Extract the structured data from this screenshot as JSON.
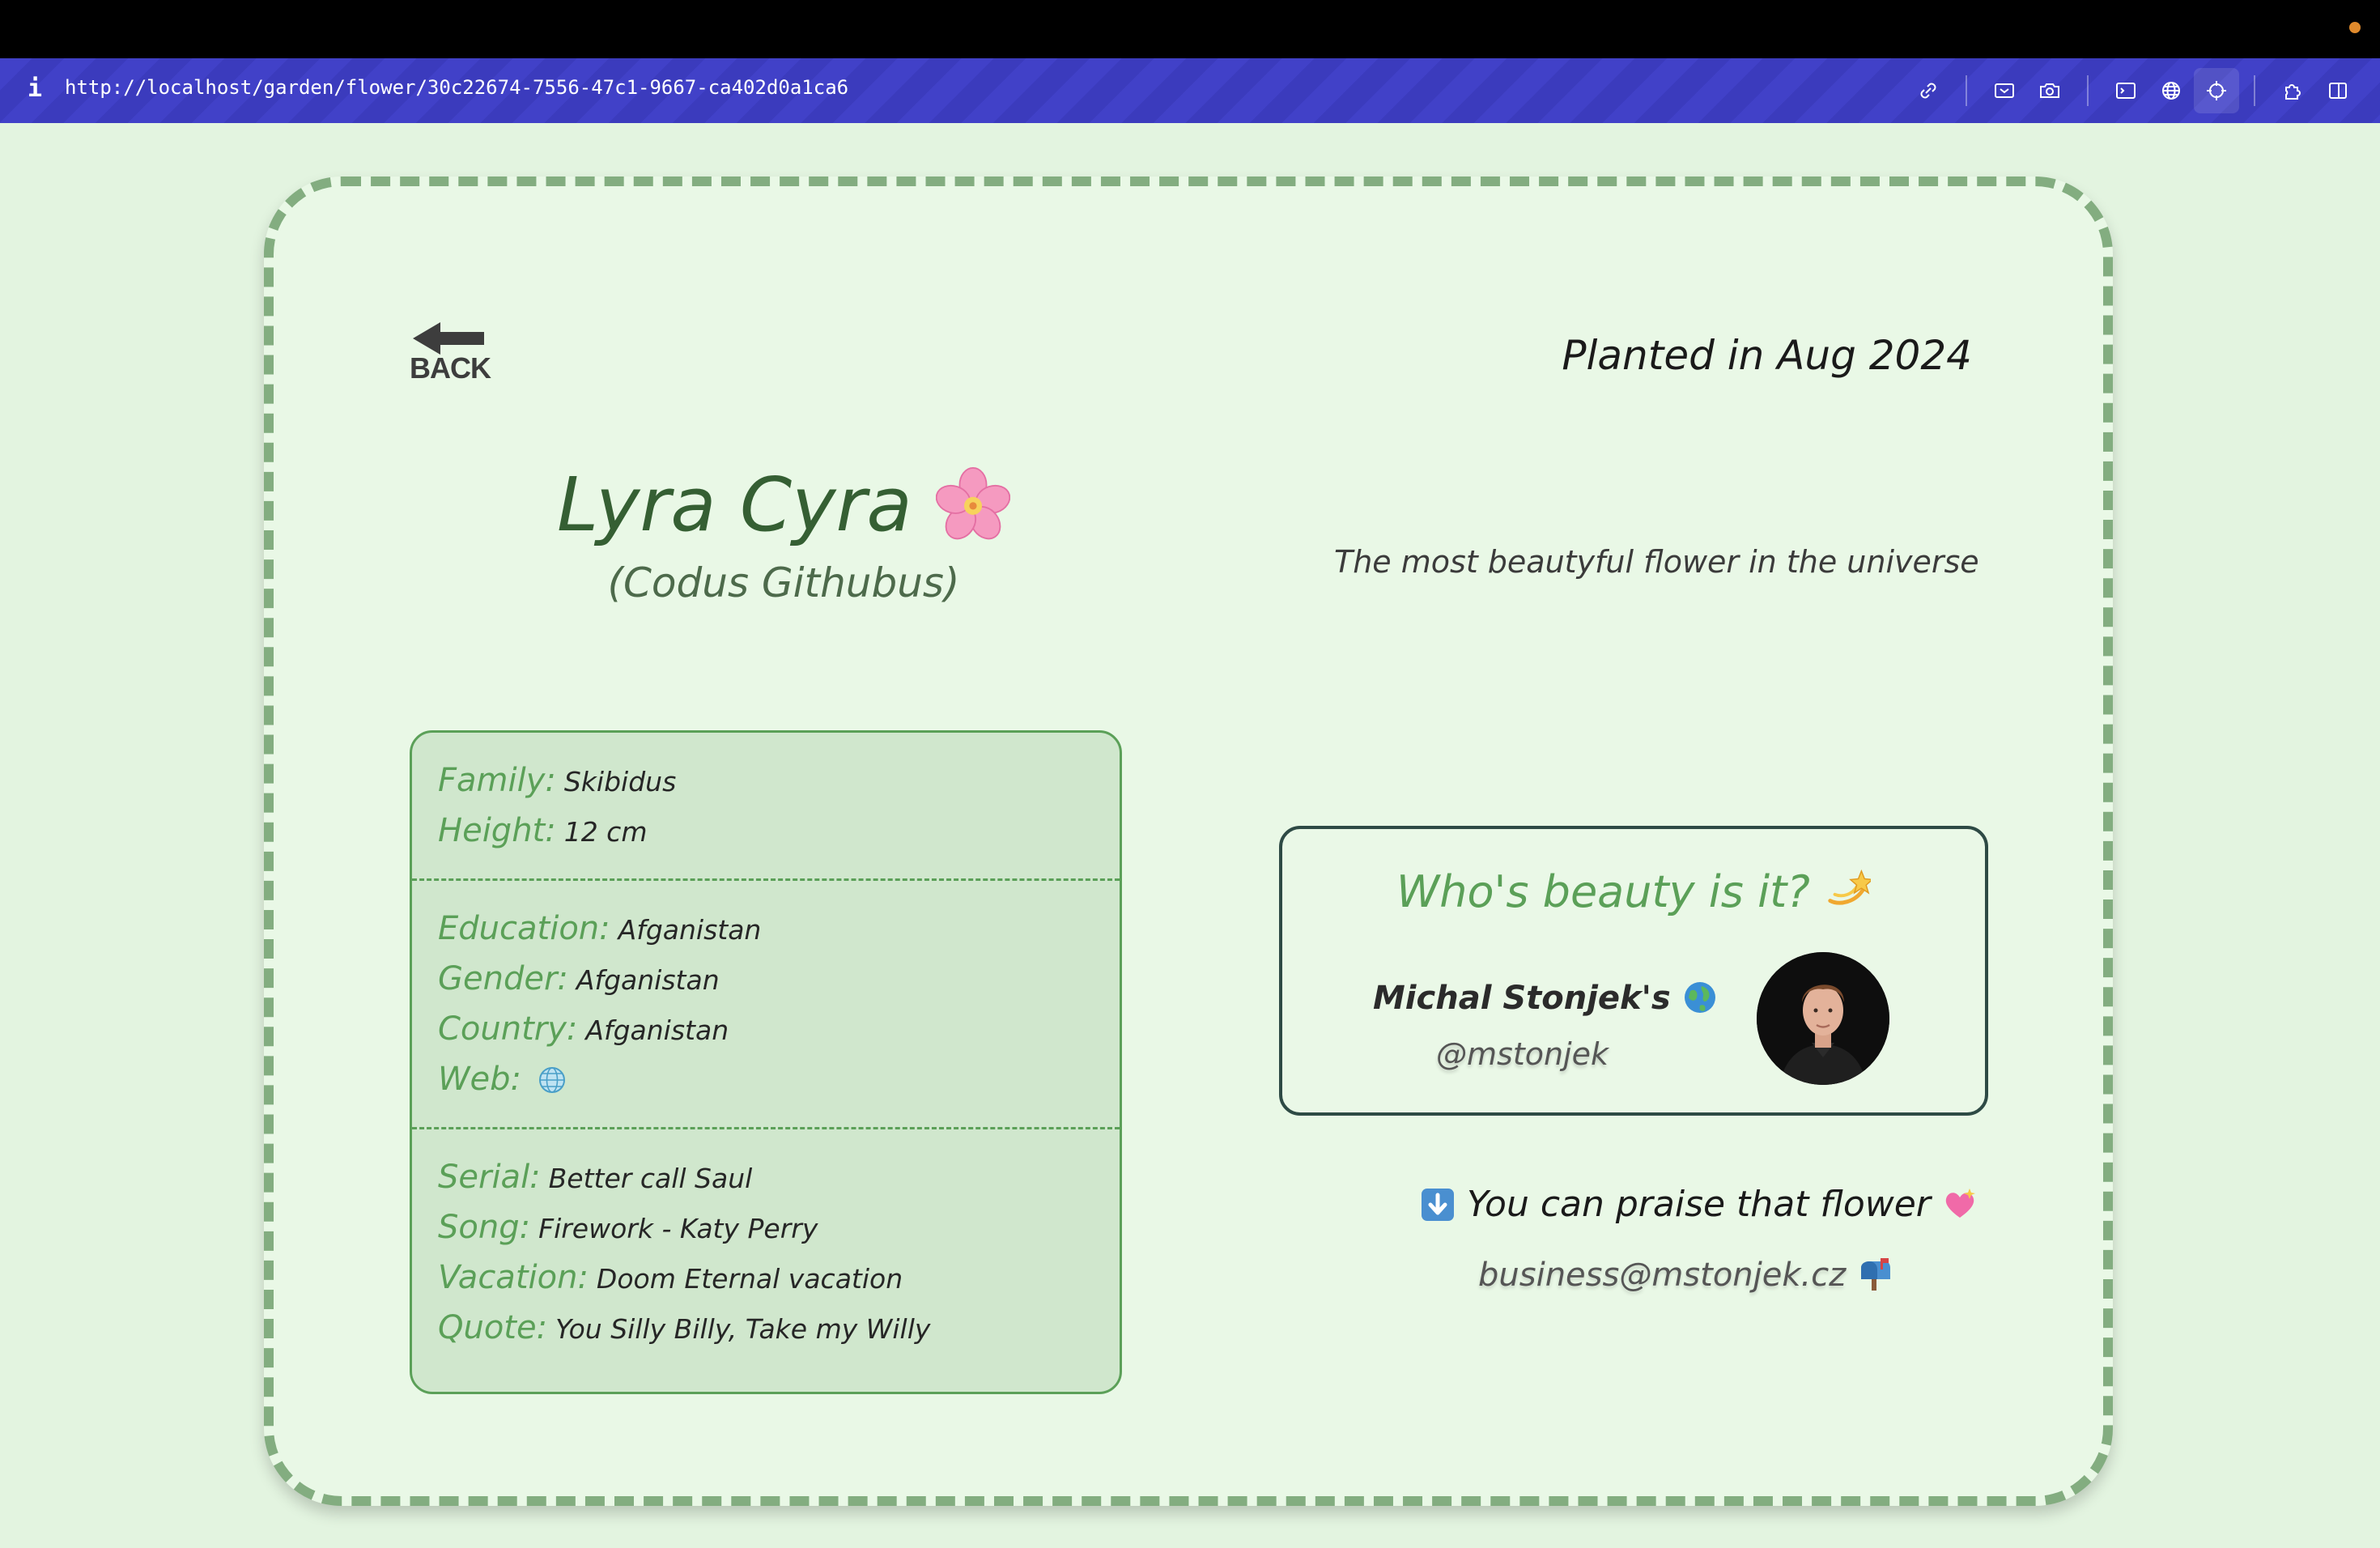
{
  "browser": {
    "info_label": "i",
    "url": "http://localhost/garden/flower/30c22674-7556-47c1-9667-ca402d0a1ca6",
    "tool_icons": [
      "link-icon",
      "screenshot-icon",
      "camera-icon",
      "terminal-icon",
      "globe-icon",
      "crosshair-icon",
      "extension-icon",
      "sidebar-icon"
    ],
    "colors": {
      "bar": "#4141c8",
      "indicator": "#e08a2c"
    }
  },
  "header": {
    "back_label": "BACK",
    "planted": "Planted in Aug 2024"
  },
  "flower": {
    "name": "Lyra Cyra",
    "latin": "(Codus Githubus)",
    "tagline": "The most beautyful flower in the universe",
    "emoji": "cherry-blossom-icon"
  },
  "details": {
    "basics": [
      {
        "key": "Family:",
        "value": "Skibidus"
      },
      {
        "key": "Height:",
        "value": "12 cm"
      }
    ],
    "origin": [
      {
        "key": "Education:",
        "value": "Afganistan"
      },
      {
        "key": "Gender:",
        "value": "Afganistan"
      },
      {
        "key": "Country:",
        "value": "Afganistan"
      }
    ],
    "web_label": "Web:",
    "favorites": [
      {
        "key": "Serial:",
        "value": "Better call Saul"
      },
      {
        "key": "Song:",
        "value": "Firework - Katy Perry"
      },
      {
        "key": "Vacation:",
        "value": "Doom Eternal vacation"
      },
      {
        "key": "Quote:",
        "value": "You Silly Billy, Take my Willy"
      }
    ]
  },
  "owner": {
    "title": "Who's beauty is it?",
    "name": "Michal Stonjek's",
    "handle": "@mstonjek"
  },
  "praise": {
    "text": "You can praise that flower",
    "email": "business@mstonjek.cz"
  },
  "colors": {
    "accent_green": "#5ba058",
    "card_bg": "#e9f8e6",
    "info_bg": "#d0e7cd",
    "border_dash": "#83ad80",
    "owner_border": "#2e4a45"
  }
}
